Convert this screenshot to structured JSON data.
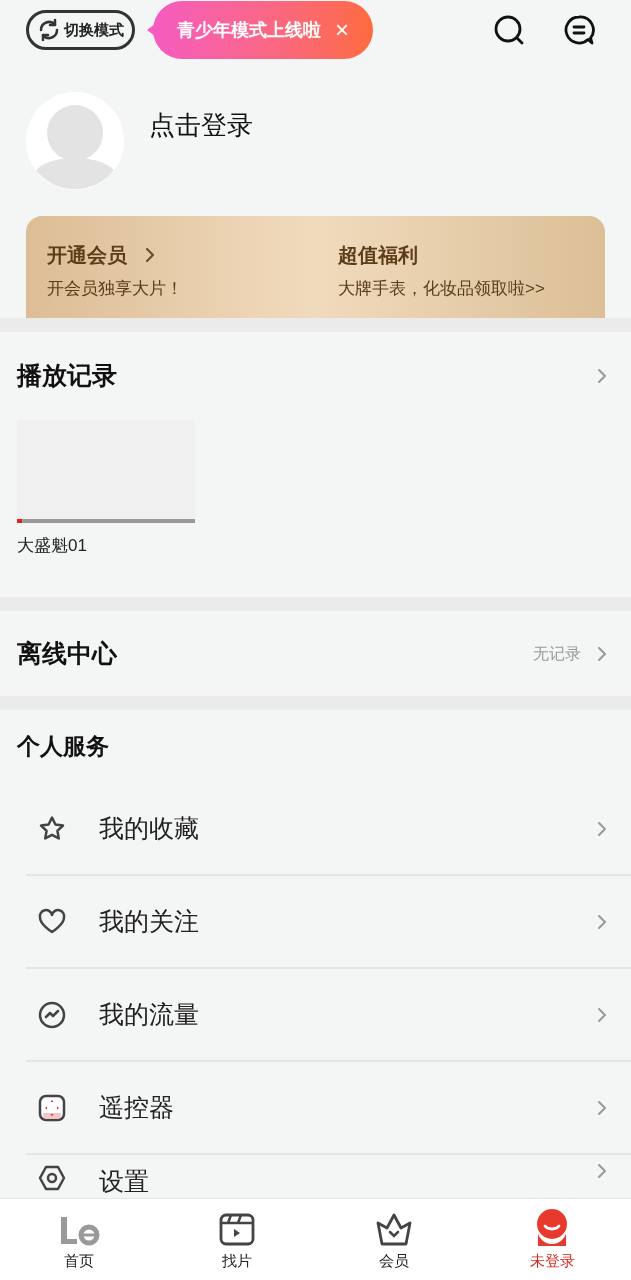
{
  "header": {
    "mode_button": "切换模式",
    "toast": {
      "text": "青少年模式上线啦",
      "close": "×"
    }
  },
  "profile": {
    "login": "点击登录"
  },
  "vip_banner": {
    "left": {
      "title": "开通会员",
      "subtitle": "开会员独享大片！"
    },
    "right": {
      "title": "超值福利",
      "subtitle": "大牌手表，化妆品领取啦>>"
    }
  },
  "history": {
    "title": "播放记录",
    "items": [
      {
        "caption": "大盛魁01",
        "level": 0.03
      }
    ]
  },
  "offline": {
    "title": "离线中心",
    "status": "无记录"
  },
  "services": {
    "title": "个人服务",
    "items": [
      {
        "kind": "star",
        "label": "我的收藏"
      },
      {
        "kind": "heart",
        "label": "我的关注"
      },
      {
        "kind": "traffic",
        "label": "我的流量"
      },
      {
        "kind": "remote",
        "label": "遥控器"
      },
      {
        "kind": "settings",
        "label": "设置"
      }
    ]
  },
  "tab_bar": [
    {
      "kind": "home",
      "label": "首页",
      "selected": false
    },
    {
      "kind": "discover",
      "label": "找片",
      "selected": false
    },
    {
      "kind": "vip",
      "label": "会员",
      "selected": false
    },
    {
      "kind": "account",
      "label": "未登录",
      "selected": true
    }
  ]
}
